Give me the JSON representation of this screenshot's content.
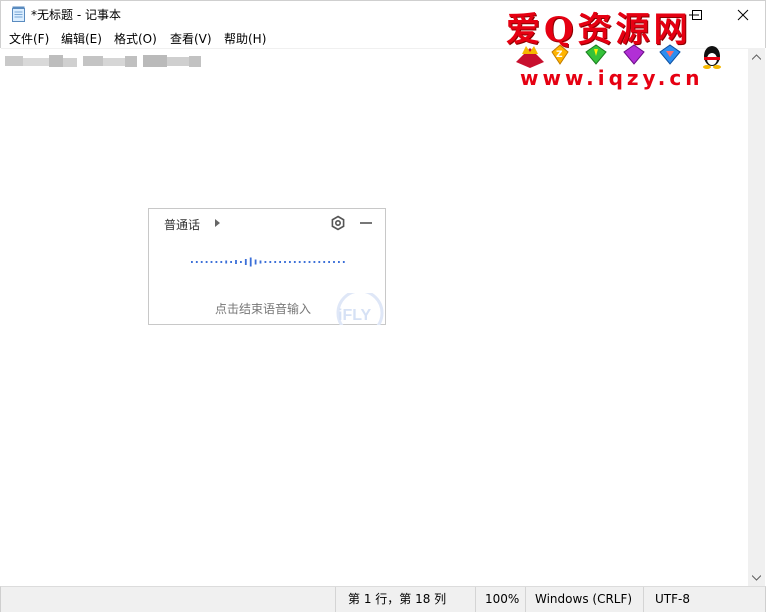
{
  "window": {
    "title": "*无标题 - 记事本"
  },
  "menubar": {
    "items": [
      {
        "label": "文件(F)"
      },
      {
        "label": "编辑(E)"
      },
      {
        "label": "格式(O)"
      },
      {
        "label": "查看(V)"
      },
      {
        "label": "帮助(H)"
      }
    ]
  },
  "statusbar": {
    "position": "第 1 行，第 18 列",
    "zoom": "100%",
    "line_ending": "Windows (CRLF)",
    "encoding": "UTF-8"
  },
  "voice_input": {
    "language": "普通话",
    "hint": "点击结束语音输入",
    "logo_text": "iFLY",
    "accent": "#3b6fd8"
  },
  "watermark": {
    "title": "爱Q资源网",
    "url": "www.iqzy.cn",
    "color": "#e60012"
  }
}
